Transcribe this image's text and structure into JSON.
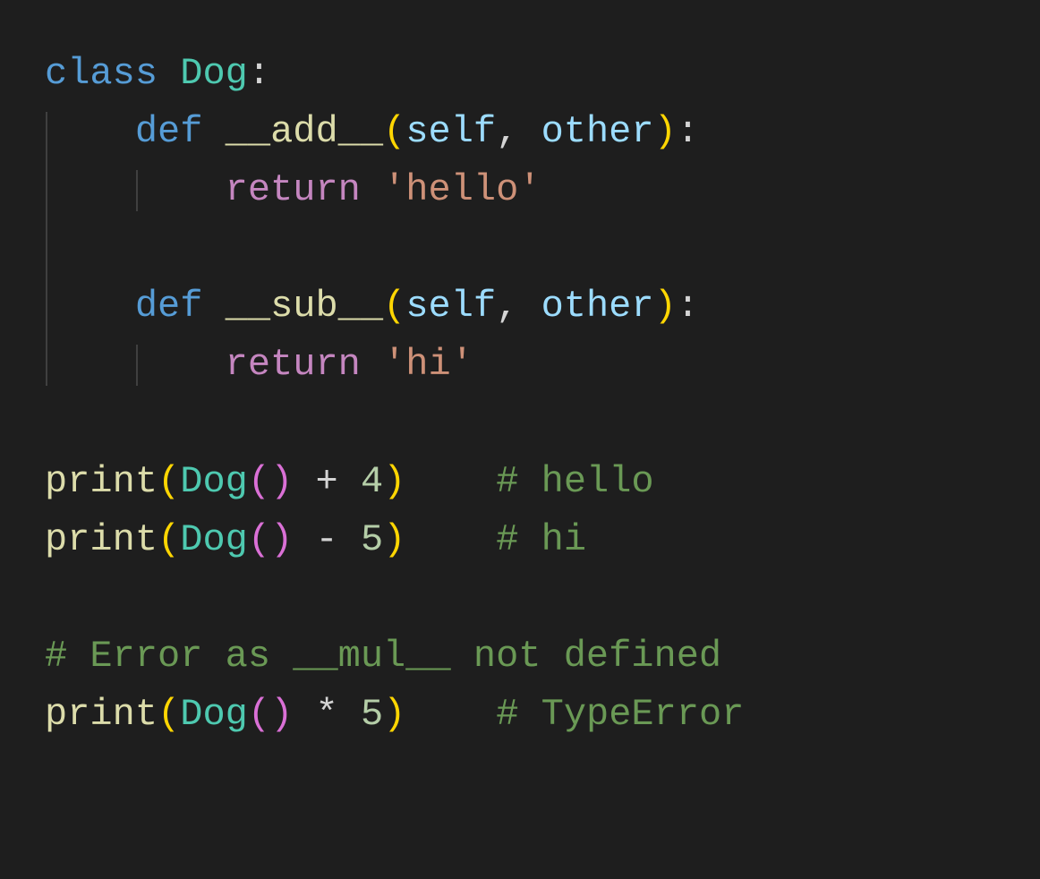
{
  "colors": {
    "background": "#1e1e1e",
    "keyword_blue": "#569cd6",
    "keyword_purple": "#c586c0",
    "class_teal": "#4ec9b0",
    "function_yellow": "#dcdcaa",
    "param_lightblue": "#9cdcfe",
    "string_orange": "#ce9178",
    "number_green": "#b5cea8",
    "comment_green": "#6a9955",
    "paren_yellow": "#ffd602",
    "paren_pink": "#da70d6",
    "default_fg": "#d4d4d4",
    "indent_guide": "#404040"
  },
  "code": {
    "language": "python",
    "lines": [
      {
        "tokens": [
          {
            "t": "class ",
            "c": "kw-class"
          },
          {
            "t": "Dog",
            "c": "cls-name"
          },
          {
            "t": ":",
            "c": "op"
          }
        ]
      },
      {
        "tokens": [
          {
            "t": "    ",
            "c": "default"
          },
          {
            "t": "def ",
            "c": "kw-def"
          },
          {
            "t": "__add__",
            "c": "fn-name"
          },
          {
            "t": "(",
            "c": "paren-y"
          },
          {
            "t": "self",
            "c": "param-self"
          },
          {
            "t": ", ",
            "c": "op"
          },
          {
            "t": "other",
            "c": "param"
          },
          {
            "t": ")",
            "c": "paren-y"
          },
          {
            "t": ":",
            "c": "op"
          }
        ]
      },
      {
        "tokens": [
          {
            "t": "        ",
            "c": "default"
          },
          {
            "t": "return ",
            "c": "kw-return"
          },
          {
            "t": "'hello'",
            "c": "string"
          }
        ]
      },
      {
        "tokens": []
      },
      {
        "tokens": [
          {
            "t": "    ",
            "c": "default"
          },
          {
            "t": "def ",
            "c": "kw-def"
          },
          {
            "t": "__sub__",
            "c": "fn-name"
          },
          {
            "t": "(",
            "c": "paren-y"
          },
          {
            "t": "self",
            "c": "param-self"
          },
          {
            "t": ", ",
            "c": "op"
          },
          {
            "t": "other",
            "c": "param"
          },
          {
            "t": ")",
            "c": "paren-y"
          },
          {
            "t": ":",
            "c": "op"
          }
        ]
      },
      {
        "tokens": [
          {
            "t": "        ",
            "c": "default"
          },
          {
            "t": "return ",
            "c": "kw-return"
          },
          {
            "t": "'hi'",
            "c": "string"
          }
        ]
      },
      {
        "tokens": []
      },
      {
        "tokens": [
          {
            "t": "print",
            "c": "fn-name"
          },
          {
            "t": "(",
            "c": "paren-y"
          },
          {
            "t": "Dog",
            "c": "cls-name"
          },
          {
            "t": "(",
            "c": "paren-p"
          },
          {
            "t": ")",
            "c": "paren-p"
          },
          {
            "t": " + ",
            "c": "op"
          },
          {
            "t": "4",
            "c": "number"
          },
          {
            "t": ")",
            "c": "paren-y"
          },
          {
            "t": "    ",
            "c": "default"
          },
          {
            "t": "# hello",
            "c": "comment"
          }
        ]
      },
      {
        "tokens": [
          {
            "t": "print",
            "c": "fn-name"
          },
          {
            "t": "(",
            "c": "paren-y"
          },
          {
            "t": "Dog",
            "c": "cls-name"
          },
          {
            "t": "(",
            "c": "paren-p"
          },
          {
            "t": ")",
            "c": "paren-p"
          },
          {
            "t": " - ",
            "c": "op"
          },
          {
            "t": "5",
            "c": "number"
          },
          {
            "t": ")",
            "c": "paren-y"
          },
          {
            "t": "    ",
            "c": "default"
          },
          {
            "t": "# hi",
            "c": "comment"
          }
        ]
      },
      {
        "tokens": []
      },
      {
        "tokens": [
          {
            "t": "# Error as __mul__ not defined",
            "c": "comment"
          }
        ]
      },
      {
        "tokens": [
          {
            "t": "print",
            "c": "fn-name"
          },
          {
            "t": "(",
            "c": "paren-y"
          },
          {
            "t": "Dog",
            "c": "cls-name"
          },
          {
            "t": "(",
            "c": "paren-p"
          },
          {
            "t": ")",
            "c": "paren-p"
          },
          {
            "t": " * ",
            "c": "op"
          },
          {
            "t": "5",
            "c": "number"
          },
          {
            "t": ")",
            "c": "paren-y"
          },
          {
            "t": "    ",
            "c": "default"
          },
          {
            "t": "# TypeError",
            "c": "comment"
          }
        ]
      }
    ],
    "indent_guides": [
      {
        "col": 1,
        "from_line": 2,
        "to_line": 6
      },
      {
        "col": 5,
        "from_line": 3,
        "to_line": 3
      },
      {
        "col": 5,
        "from_line": 6,
        "to_line": 6
      }
    ]
  }
}
